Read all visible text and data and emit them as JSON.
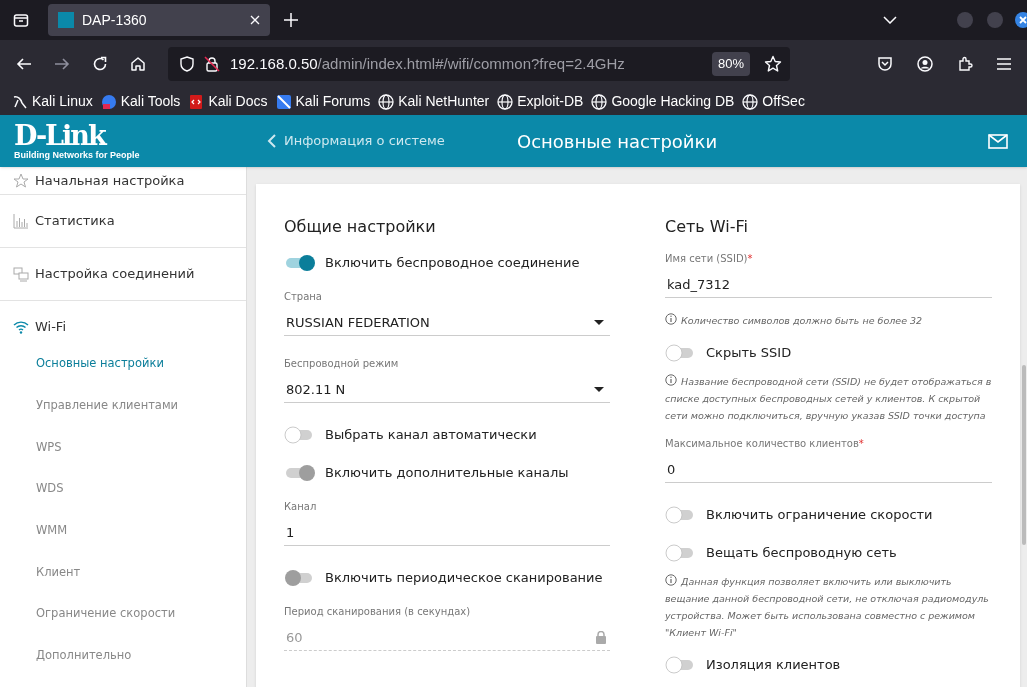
{
  "browser": {
    "tab_title": "DAP-1360",
    "url_host": "192.168.0.50",
    "url_path": "/admin/index.html#/wifi/common?freq=2.4GHz",
    "zoom": "80%",
    "bookmarks": [
      {
        "label": "Kali Linux"
      },
      {
        "label": "Kali Tools"
      },
      {
        "label": "Kali Docs"
      },
      {
        "label": "Kali Forums"
      },
      {
        "label": "Kali NetHunter"
      },
      {
        "label": "Exploit-DB"
      },
      {
        "label": "Google Hacking DB"
      },
      {
        "label": "OffSec"
      }
    ]
  },
  "header": {
    "logo": "D-Link",
    "logo_tagline": "Building Networks for People",
    "back_link": "Информация о системе",
    "title": "Основные настройки"
  },
  "sidebar": {
    "items": [
      {
        "label": "Начальная настройка",
        "expanded": false
      },
      {
        "label": "Статистика",
        "expanded": false
      },
      {
        "label": "Настройка соединений",
        "expanded": false
      },
      {
        "label": "Wi-Fi",
        "expanded": true,
        "children": [
          {
            "label": "Основные настройки",
            "selected": true
          },
          {
            "label": "Управление клиентами",
            "selected": false
          },
          {
            "label": "WPS",
            "selected": false
          },
          {
            "label": "WDS",
            "selected": false
          },
          {
            "label": "WMM",
            "selected": false
          },
          {
            "label": "Клиент",
            "selected": false
          },
          {
            "label": "Ограничение скорости",
            "selected": false
          },
          {
            "label": "Дополнительно",
            "selected": false
          }
        ]
      }
    ]
  },
  "general": {
    "title": "Общие настройки",
    "fields": [
      {
        "kind": "toggle",
        "label": "Включить беспроводное соединение",
        "on": true,
        "disabled": false
      },
      {
        "kind": "select",
        "label": "Страна",
        "value": "RUSSIAN FEDERATION"
      },
      {
        "kind": "select",
        "label": "Беспроводной режим",
        "value": "802.11 N"
      },
      {
        "kind": "toggle",
        "label": "Выбрать канал автоматически",
        "on": false,
        "disabled": false
      },
      {
        "kind": "toggle",
        "label": "Включить дополнительные каналы",
        "on": true,
        "disabled": true
      },
      {
        "kind": "input",
        "label": "Канал",
        "value": "1"
      },
      {
        "kind": "toggle",
        "label": "Включить периодическое сканирование",
        "on": false,
        "disabled": true
      },
      {
        "kind": "locked",
        "label": "Период сканирования (в секундах)",
        "value": "60"
      }
    ]
  },
  "wifi": {
    "title": "Сеть Wi-Fi",
    "fields": [
      {
        "kind": "input",
        "label": "Имя сети (SSID)",
        "value": "kad_7312",
        "required_mark": "*"
      },
      {
        "kind": "hint",
        "text": "Количество символов должно быть не более 32"
      },
      {
        "kind": "toggle",
        "label": "Скрыть SSID",
        "on": false,
        "disabled": false
      },
      {
        "kind": "hint",
        "text": "Название беспроводной сети (SSID) не будет отображаться в списке доступных беспроводных сетей у клиентов. К скрытой сети можно подключиться, вручную указав SSID точки доступа"
      },
      {
        "kind": "input",
        "label": "Максимальное количество клиентов",
        "value": "0",
        "required_mark": "*"
      },
      {
        "kind": "toggle",
        "label": "Включить ограничение скорости",
        "on": false,
        "disabled": false
      },
      {
        "kind": "toggle",
        "label": "Вещать беспроводную сеть",
        "on": false,
        "disabled": false
      },
      {
        "kind": "hint",
        "text": "Данная функция позволяет включить или выключить вещание данной беспроводной сети, не отключая радиомодуль устройства. Может быть использована совместно с режимом \"Клиент Wi-Fi\""
      },
      {
        "kind": "toggle",
        "label": "Изоляция клиентов",
        "on": false,
        "disabled": false
      }
    ]
  }
}
